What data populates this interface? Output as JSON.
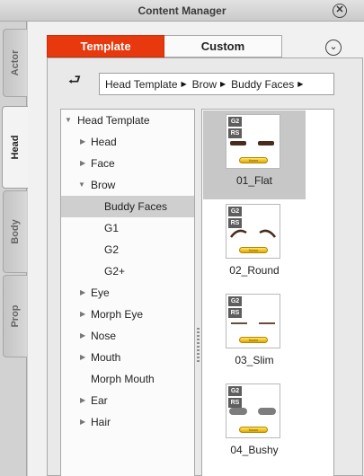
{
  "window": {
    "title": "Content Manager",
    "close_icon": "close-circle-icon"
  },
  "side_tabs": [
    {
      "label": "Actor",
      "active": false
    },
    {
      "label": "Head",
      "active": true
    },
    {
      "label": "Body",
      "active": false
    },
    {
      "label": "Prop",
      "active": false
    }
  ],
  "top_tabs": {
    "template": "Template",
    "custom": "Custom",
    "active": "Template"
  },
  "options_icon": "chevron-down-circle-icon",
  "back_icon": "return-arrow-icon",
  "breadcrumb": [
    "Head Template",
    "Brow",
    "Buddy Faces"
  ],
  "tree": [
    {
      "label": "Head Template",
      "expanded": true
    },
    {
      "label": "Head",
      "expanded": false
    },
    {
      "label": "Face",
      "expanded": false
    },
    {
      "label": "Brow",
      "expanded": true
    },
    {
      "label": "Buddy Faces",
      "selected": true
    },
    {
      "label": "G1"
    },
    {
      "label": "G2"
    },
    {
      "label": "G2+"
    },
    {
      "label": "Eye",
      "expanded": false
    },
    {
      "label": "Morph Eye",
      "expanded": false
    },
    {
      "label": "Nose",
      "expanded": false
    },
    {
      "label": "Mouth",
      "expanded": false
    },
    {
      "label": "Morph Mouth"
    },
    {
      "label": "Ear",
      "expanded": false
    },
    {
      "label": "Hair",
      "expanded": false
    }
  ],
  "items": [
    {
      "caption": "01_Flat",
      "selected": true,
      "badges": [
        "G2",
        "RS"
      ],
      "pill": "Name"
    },
    {
      "caption": "02_Round",
      "selected": false,
      "badges": [
        "G2",
        "RS"
      ],
      "pill": "Name"
    },
    {
      "caption": "03_Slim",
      "selected": false,
      "badges": [
        "G2",
        "RS"
      ],
      "pill": "Name"
    },
    {
      "caption": "04_Bushy",
      "selected": false,
      "badges": [
        "G2",
        "RS"
      ],
      "pill": "Name"
    }
  ],
  "colors": {
    "accent": "#e8380d",
    "selection": "#cfcfcf",
    "brow_dark": "#4a2a1c",
    "brow_grey": "#7d7d7d"
  }
}
